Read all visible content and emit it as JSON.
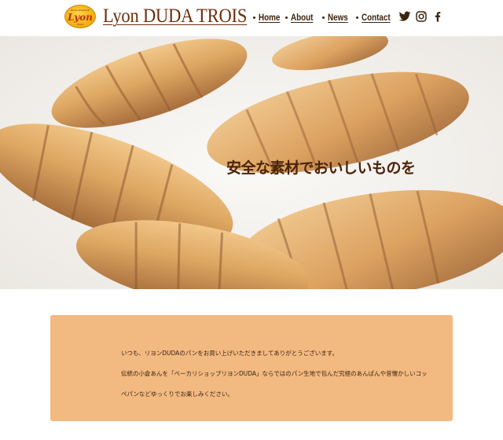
{
  "header": {
    "logo": {
      "top_text": "BOULANGERIE",
      "main_text": "Lyon",
      "bottom_text": "DUDA"
    },
    "site_title": "Lyon DUDA TROIS",
    "nav": [
      {
        "label": "Home"
      },
      {
        "label": "About"
      },
      {
        "label": "News"
      },
      {
        "label": "Contact"
      }
    ],
    "social": [
      {
        "icon": "twitter-icon"
      },
      {
        "icon": "instagram-icon"
      },
      {
        "icon": "facebook-icon"
      }
    ]
  },
  "hero": {
    "headline": "安全な素材でおいしいものを"
  },
  "message": {
    "lines": [
      "いつも、リヨンDUDAのパンをお買い上げいただきましてありがとうございます。",
      "伝統の小倉あんを「ベーカリショップリヨンDUDA」ならではのパン生地で包んだ究極のあんぱんや昔懐かしいコッ",
      "ペパンなどゆっくりでお楽しみください。"
    ]
  },
  "colors": {
    "brand_brown": "#6b2e0c",
    "text_dark": "#3a2410",
    "message_bg": "#f2b981",
    "logo_gold": "#f5b315"
  }
}
